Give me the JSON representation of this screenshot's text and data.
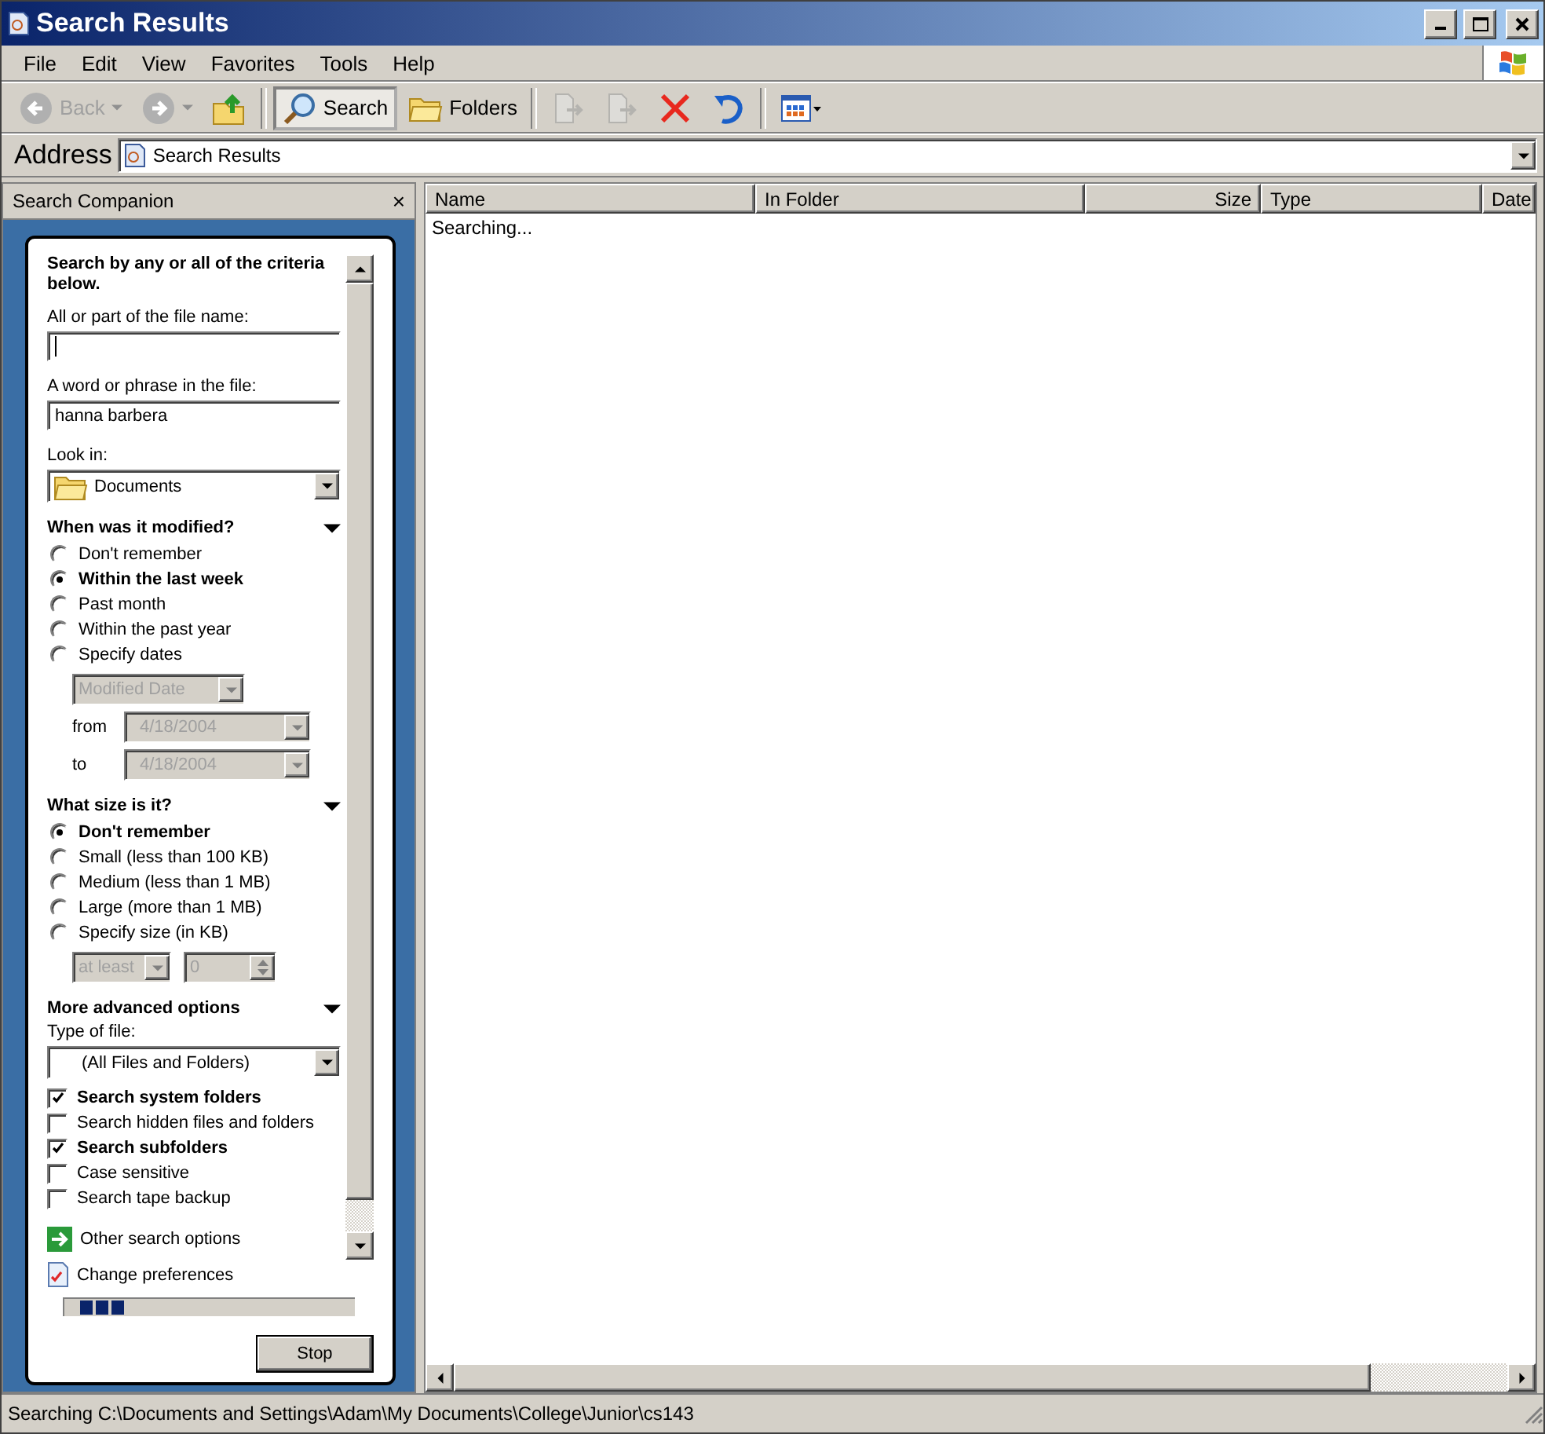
{
  "window": {
    "title": "Search Results"
  },
  "menu": [
    {
      "label": "File"
    },
    {
      "label": "Edit"
    },
    {
      "label": "View"
    },
    {
      "label": "Favorites"
    },
    {
      "label": "Tools"
    },
    {
      "label": "Help"
    }
  ],
  "toolbar": [
    {
      "kind": "nav",
      "label": "Back",
      "disabled": true
    },
    {
      "kind": "nav",
      "disabled": true
    },
    {
      "kind": "icon",
      "disabled": false
    },
    {
      "kind": "sep"
    },
    {
      "kind": "toggle",
      "label": "Search",
      "selected": true
    },
    {
      "kind": "toggle",
      "label": "Folders",
      "selected": false
    },
    {
      "kind": "sep"
    },
    {
      "kind": "icon",
      "disabled": true
    },
    {
      "kind": "icon",
      "disabled": true
    },
    {
      "kind": "icon",
      "disabled": false
    },
    {
      "kind": "icon",
      "disabled": false
    },
    {
      "kind": "sep"
    },
    {
      "kind": "icon",
      "disabled": false
    }
  ],
  "address": {
    "label": "Address",
    "value": "Search Results"
  },
  "search_companion": {
    "title": "Search Companion",
    "close": "×",
    "heading": "Search by any or all of the criteria below.",
    "file_name": {
      "label": "All or part of the file name:"
    },
    "phrase": {
      "label": "A word or phrase in the file:",
      "value": "hanna barbera"
    },
    "look_in": {
      "label": "Look in:",
      "value": "Documents"
    },
    "modified": {
      "title": "When was it modified?",
      "expanded": true,
      "options": [
        {
          "label": "Don't remember",
          "selected": false
        },
        {
          "label": "Within the last week",
          "selected": true
        },
        {
          "label": "Past month",
          "selected": false
        },
        {
          "label": "Within the past year",
          "selected": false
        },
        {
          "label": "Specify dates",
          "selected": false
        }
      ],
      "date_type": {
        "value": "Modified Date",
        "disabled": true
      },
      "from": {
        "label": "from",
        "value": "4/18/2004",
        "disabled": true
      },
      "to": {
        "label": "to",
        "value": "4/18/2004",
        "disabled": true
      }
    },
    "size": {
      "title": "What size is it?",
      "expanded": true,
      "options": [
        {
          "label": "Don't remember",
          "selected": true
        },
        {
          "label": "Small (less than 100 KB)",
          "selected": false
        },
        {
          "label": "Medium (less than 1 MB)",
          "selected": false
        },
        {
          "label": "Large (more than 1 MB)",
          "selected": false
        },
        {
          "label": "Specify size (in KB)",
          "selected": false
        }
      ],
      "comparison": {
        "value": "at least",
        "disabled": true
      },
      "amount": {
        "value": "0",
        "disabled": true
      }
    },
    "advanced": {
      "title": "More advanced options",
      "expanded": true,
      "type_label": "Type of file:",
      "type_value": "(All Files and Folders)",
      "checks": [
        {
          "label": "Search system folders",
          "checked": true
        },
        {
          "label": "Search hidden files and folders",
          "checked": false
        },
        {
          "label": "Search subfolders",
          "checked": true
        },
        {
          "label": "Case sensitive",
          "checked": false
        },
        {
          "label": "Search tape backup",
          "checked": false
        }
      ]
    },
    "links": [
      {
        "label": "Other search options"
      },
      {
        "label": "Change preferences"
      }
    ],
    "progress": {
      "level": 0.17
    },
    "stop": "Stop"
  },
  "results": {
    "columns": [
      {
        "label": "Name"
      },
      {
        "label": "In Folder"
      },
      {
        "label": "Size"
      },
      {
        "label": "Type"
      },
      {
        "label": "Date"
      }
    ],
    "message": "Searching..."
  },
  "status_bar": {
    "text": "Searching C:\\Documents and Settings\\Adam\\My Documents\\College\\Junior\\cs143"
  }
}
